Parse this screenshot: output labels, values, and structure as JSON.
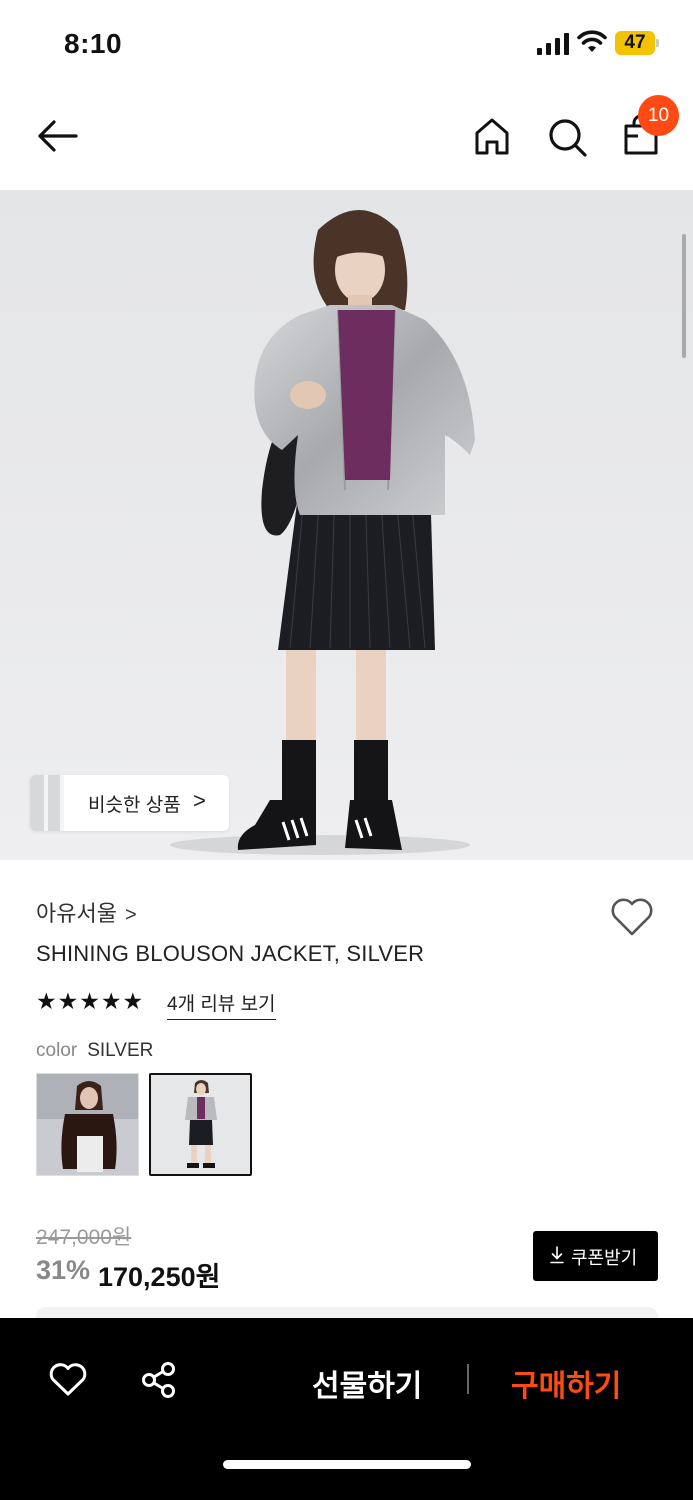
{
  "status_bar": {
    "time": "8:10",
    "battery": "47"
  },
  "nav": {
    "cart_count": "10"
  },
  "hero": {
    "similar_label": "비슷한 상품",
    "similar_chevron": ">"
  },
  "product": {
    "brand": "아유서울",
    "brand_chevron": ">",
    "title": "SHINING BLOUSON JACKET, SILVER",
    "stars": "★★★★★",
    "rating": 5,
    "review_link": "4개 리뷰 보기",
    "color_key": "color",
    "color_value": "SILVER",
    "selected_swatch": 2
  },
  "price": {
    "original": "247,000원",
    "discount": "31%",
    "sale": "170,250원",
    "coupon_label": "쿠폰받기"
  },
  "bottom": {
    "gift_label": "선물하기",
    "buy_label": "구매하기"
  },
  "colors": {
    "accent": "#ff4b13",
    "badge": "#ff4b13",
    "battery": "#f3c200",
    "bottom_bar": "#000000"
  },
  "icons": [
    "back-arrow-icon",
    "home-icon",
    "search-icon",
    "shopping-bag-icon",
    "heart-icon",
    "share-icon",
    "download-icon"
  ]
}
